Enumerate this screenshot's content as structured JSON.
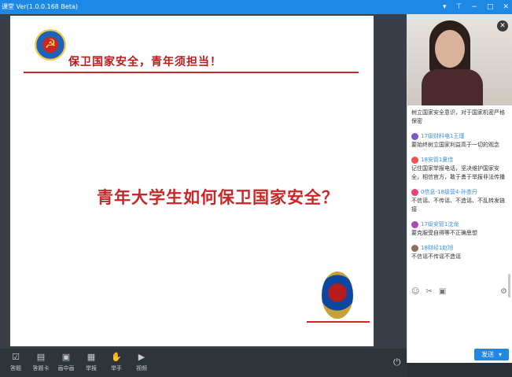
{
  "window": {
    "title": "课堂 Ver(1.0.0.168 Beta)",
    "controls": [
      "▾",
      "⊤",
      "−",
      "□",
      "✕"
    ]
  },
  "slide": {
    "slogan": "保卫国家安全，青年须担当！",
    "headline": "青年大学生如何保卫国家安全？"
  },
  "toolbar": [
    {
      "label": "答题",
      "icon": "checklist-icon"
    },
    {
      "label": "答题卡",
      "icon": "card-icon"
    },
    {
      "label": "画中画",
      "icon": "pip-icon"
    },
    {
      "label": "举报",
      "icon": "report-icon"
    },
    {
      "label": "举手",
      "icon": "hand-icon"
    },
    {
      "label": "视频",
      "icon": "video-icon"
    }
  ],
  "chat": [
    {
      "name": "",
      "text": "树立国家安全意识，对于国家机密严格保密"
    },
    {
      "name": "17级财科电1王瑾",
      "text": "要始终树立国家利益高于一切的观念"
    },
    {
      "name": "18安管1夏佳",
      "text": "记住国家举报电话，坚决维护国家安全，相信官方，敢于勇于举报非法传播"
    },
    {
      "name": "0信息-18级营4-孙查丹",
      "text": "不信谣、不传谣、不造谣、不乱转发链接"
    },
    {
      "name": "17级安管1沈龙",
      "text": "要克服受自得等不正确思想"
    },
    {
      "name": "18财经1赵旭",
      "text": "不信谣不传谣不造谣"
    }
  ],
  "input_icons": [
    "emoji-icon",
    "scissors-icon",
    "image-icon",
    "settings-icon"
  ],
  "send": {
    "label": "发送",
    "arrow": "▾"
  }
}
